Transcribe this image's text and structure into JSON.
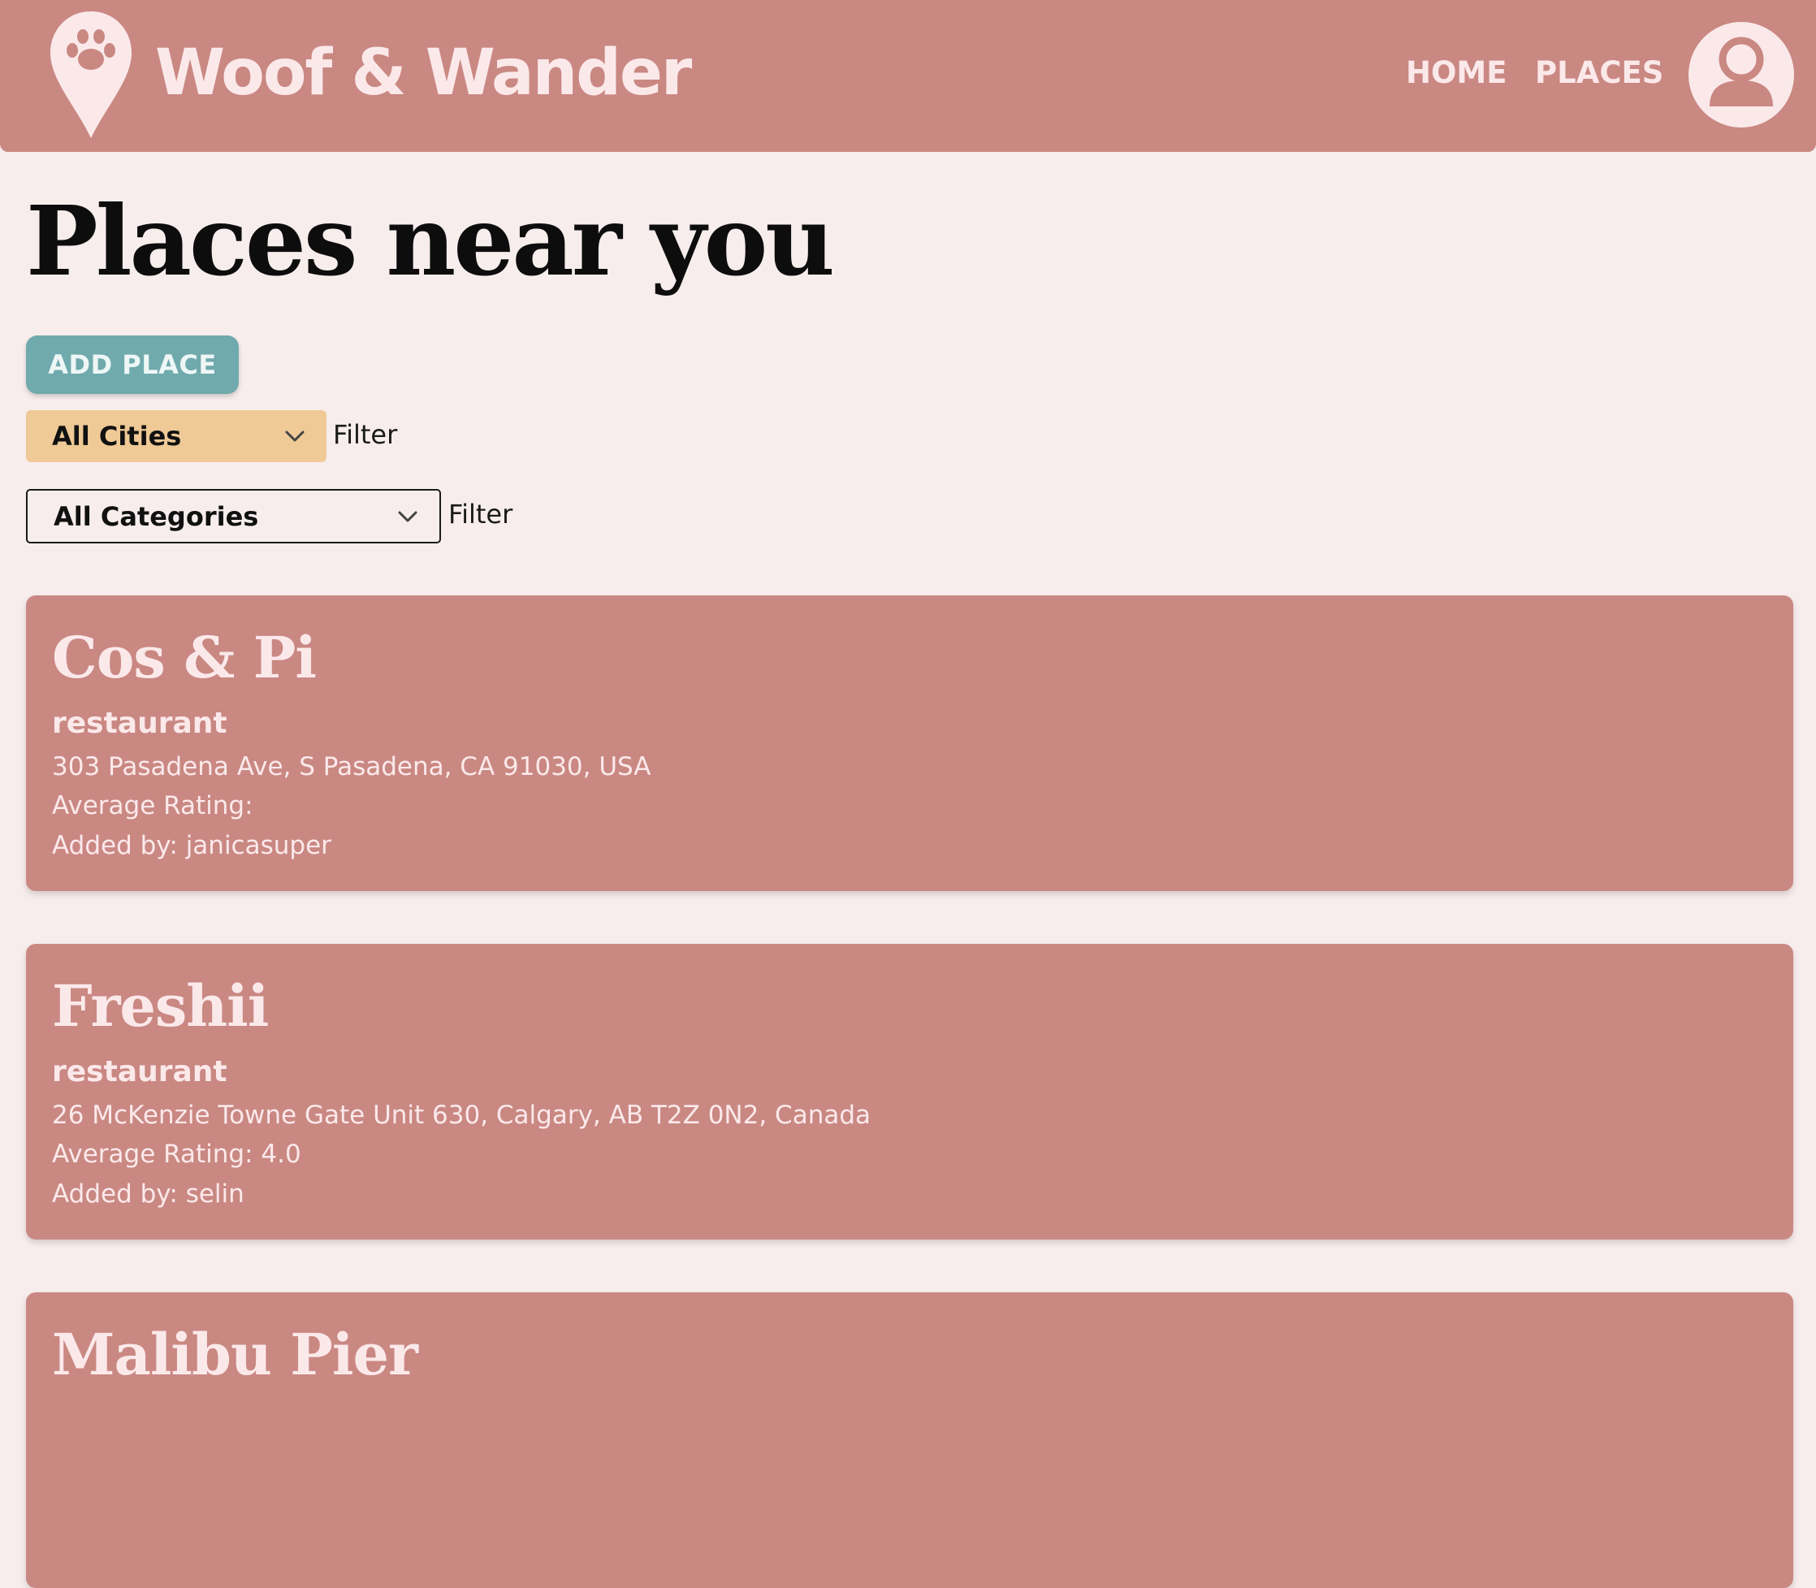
{
  "header": {
    "brand": "Woof & Wander",
    "nav": {
      "home": "HOME",
      "places": "PLACES"
    }
  },
  "page": {
    "title": "Places near you"
  },
  "actions": {
    "add_place": "ADD PLACE"
  },
  "filters": {
    "city": {
      "selected": "All Cities",
      "button_label": "Filter"
    },
    "category": {
      "selected": "All Categories",
      "button_label": "Filter"
    }
  },
  "places": [
    {
      "name": "Cos & Pi",
      "category": "restaurant",
      "address": "303 Pasadena Ave, S Pasadena, CA 91030, USA",
      "rating": "Average Rating: ",
      "added_by": "Added by: janicasuper"
    },
    {
      "name": "Freshii",
      "category": "restaurant",
      "address": "26 McKenzie Towne Gate Unit 630, Calgary, AB T2Z 0N2, Canada",
      "rating": "Average Rating: 4.0",
      "added_by": "Added by: selin"
    },
    {
      "name": "Malibu Pier"
    }
  ],
  "colors": {
    "header_bg": "#ca8883",
    "page_bg": "#f8eded",
    "card_bg": "#ca8883",
    "accent_teal": "#70aaad",
    "city_select_bg": "#efc996",
    "light_text": "#fbe9ea"
  },
  "icons": {
    "logo": "map-pin-paw-icon",
    "avatar": "user-icon",
    "dropdown": "chevron-down-icon"
  }
}
